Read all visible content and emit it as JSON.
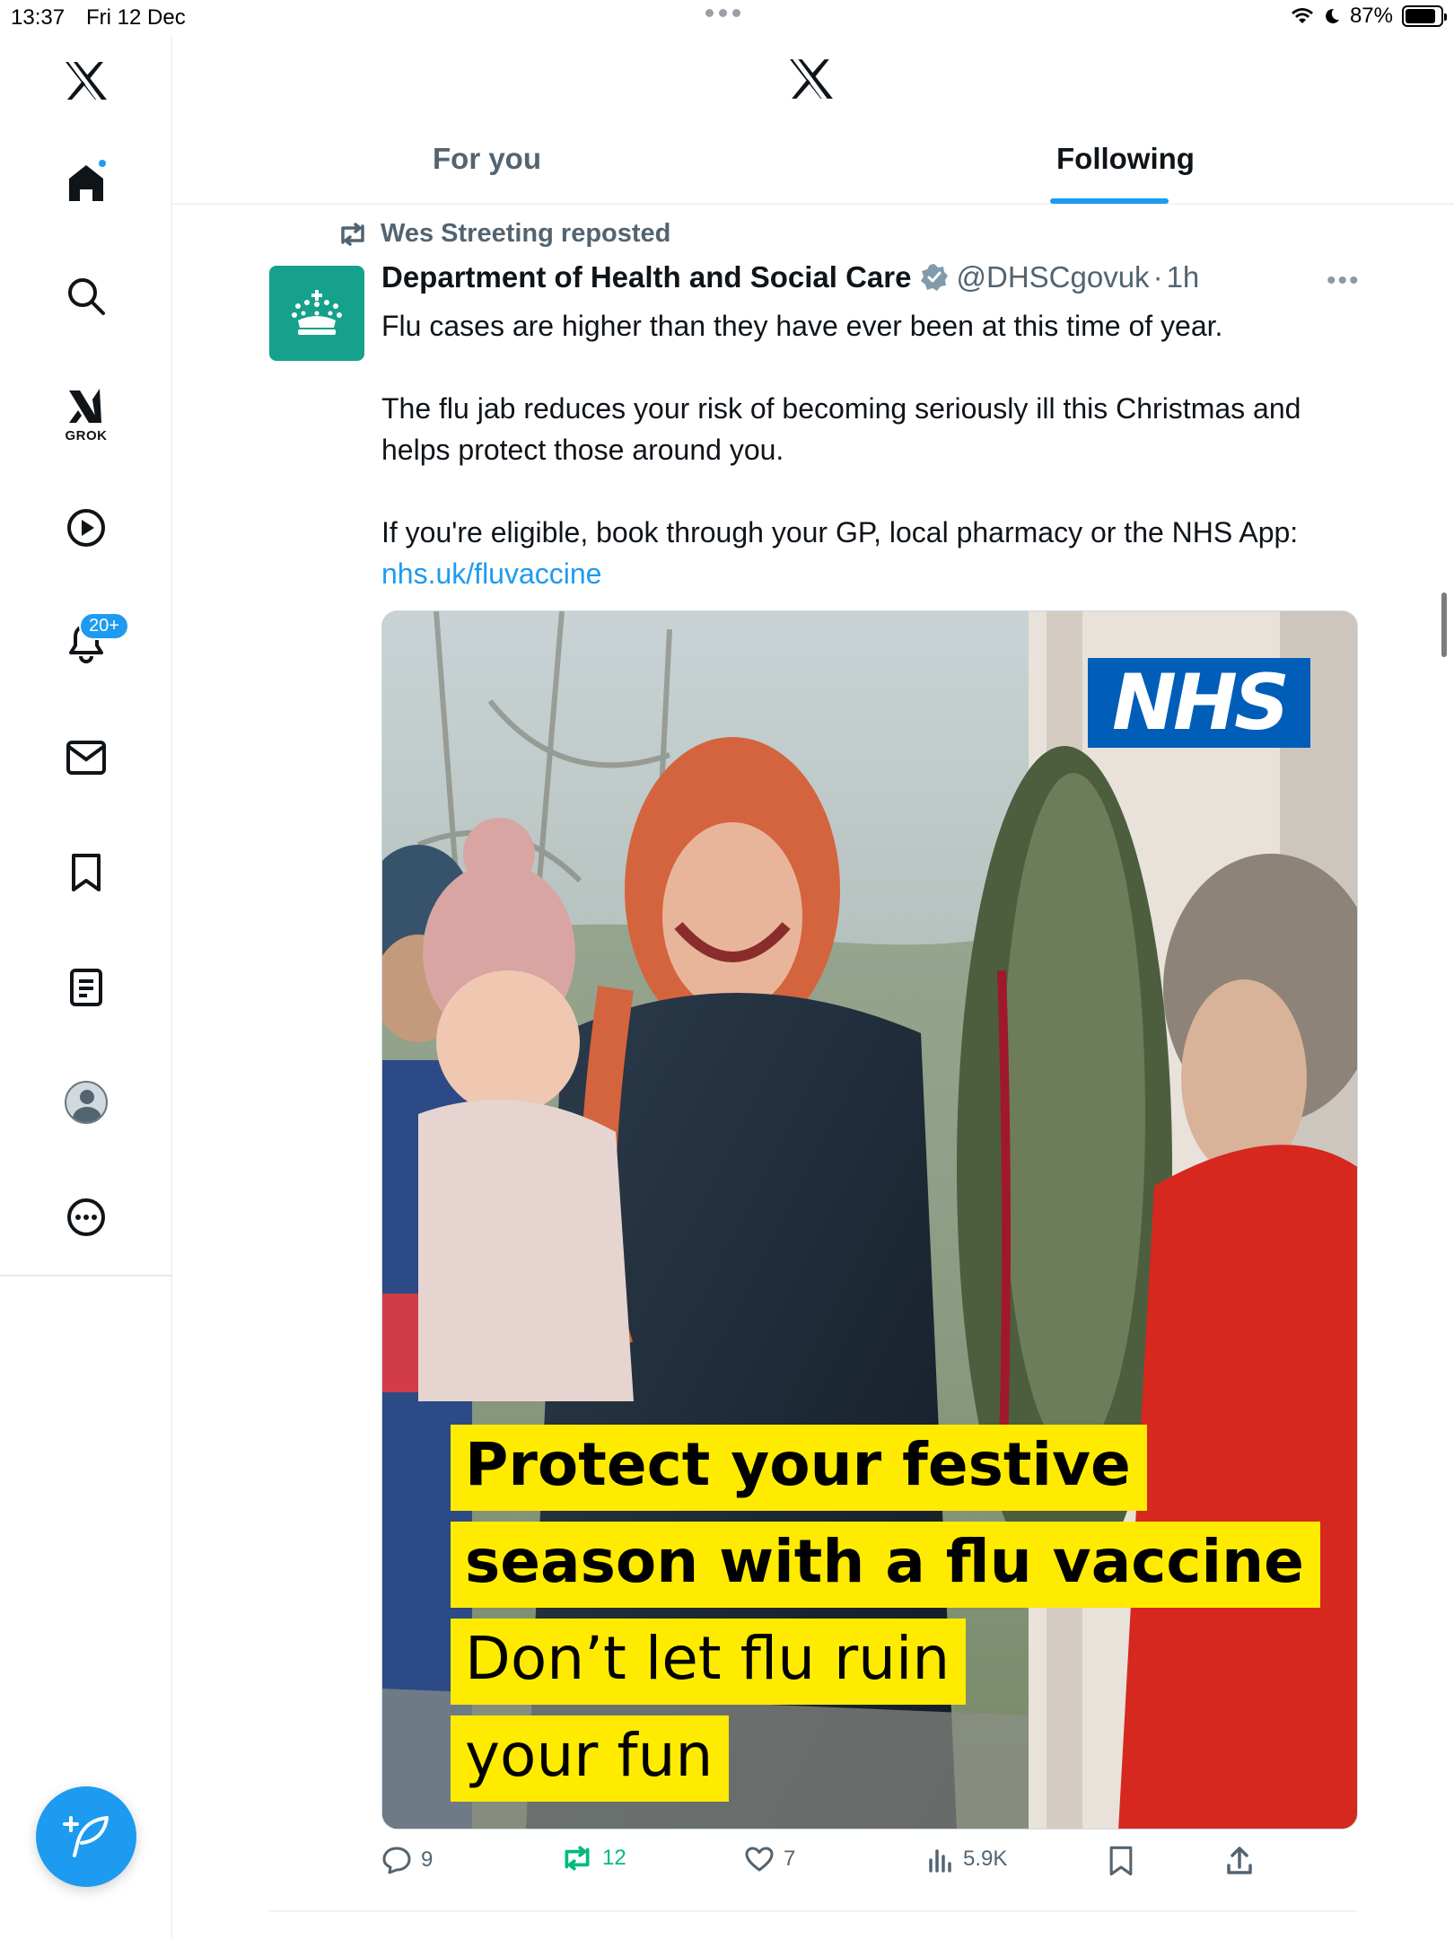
{
  "status_bar": {
    "time": "13:37",
    "date": "Fri 12 Dec",
    "battery": "87%",
    "battery_level": 0.87
  },
  "sidebar": {
    "items": [
      {
        "name": "home",
        "icon": "home-icon",
        "active": true,
        "has_dot": true
      },
      {
        "name": "explore",
        "icon": "search-icon"
      },
      {
        "name": "grok",
        "icon": "grok-icon",
        "label": "GROK"
      },
      {
        "name": "video",
        "icon": "play-icon"
      },
      {
        "name": "notifications",
        "icon": "bell-icon",
        "badge": "20+"
      },
      {
        "name": "messages",
        "icon": "envelope-icon"
      },
      {
        "name": "bookmarks",
        "icon": "bookmark-icon"
      },
      {
        "name": "lists",
        "icon": "list-icon"
      },
      {
        "name": "profile",
        "icon": "avatar-icon"
      },
      {
        "name": "more",
        "icon": "more-circle-icon"
      }
    ],
    "compose_icon": "compose-feather-icon"
  },
  "header": {
    "tabs": [
      {
        "label": "For you",
        "active": false
      },
      {
        "label": "Following",
        "active": true
      }
    ]
  },
  "post": {
    "repost_by": "Wes Streeting reposted",
    "author_name": "Department of Health and Social Care",
    "handle": "@DHSCgovuk",
    "separator": "·",
    "time": "1h",
    "text_lines": [
      "Flu cases are higher than they have ever been at this time of year.",
      "The flu jab reduces your risk of becoming seriously ill this Christmas and helps protect those around you.",
      "If you're eligible, book through your GP, local pharmacy or the NHS App:"
    ],
    "link": "nhs.uk/fluvaccine",
    "media": {
      "logo_text": "NHS",
      "caption": [
        "Protect your festive",
        "season with a flu vaccine",
        "Don’t let flu ruin",
        "your fun"
      ]
    },
    "actions": {
      "replies": "9",
      "reposts": "12",
      "likes": "7",
      "views": "5.9K"
    }
  },
  "colors": {
    "accent": "#1d9bf0",
    "repost_green": "#00ba7c",
    "muted": "#536471",
    "dhsc_green": "#15a18b",
    "nhs_blue": "#005eb8",
    "caption_yellow": "#ffeb00"
  }
}
